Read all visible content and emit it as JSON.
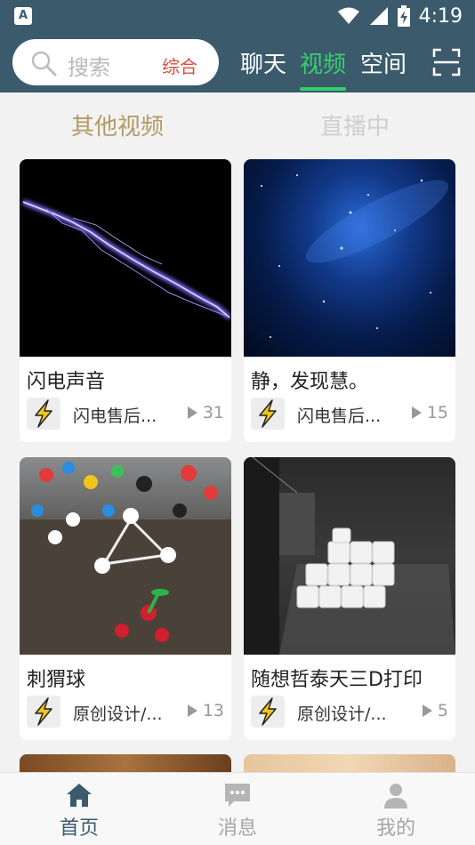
{
  "status_bar": {
    "time": "4:19",
    "notification_icon": "text-a-icon",
    "icons": [
      "wifi-icon",
      "signal-icon",
      "battery-charging-icon"
    ]
  },
  "header": {
    "search": {
      "placeholder": "搜索",
      "scope": "综合"
    },
    "tabs": [
      {
        "label": "聊天",
        "active": false
      },
      {
        "label": "视频",
        "active": true
      },
      {
        "label": "空间",
        "active": false
      }
    ],
    "scan_icon": "scan-icon",
    "accent_color": "#34d06b",
    "header_color": "#3b5b6d"
  },
  "subtabs": [
    {
      "label": "其他视频",
      "active": true
    },
    {
      "label": "直播中",
      "active": false
    }
  ],
  "videos": [
    {
      "title": "闪电声音",
      "author": "闪电售后...",
      "plays": "31",
      "thumb": "lightning"
    },
    {
      "title": "静，发现慧。",
      "author": "闪电售后...",
      "plays": "15",
      "thumb": "milky-way"
    },
    {
      "title": "刺猬球",
      "author": "原创设计/...",
      "plays": "13",
      "thumb": "molecule-toys"
    },
    {
      "title": "随想哲泰天三D打印",
      "author": "原创设计/...",
      "plays": "5",
      "thumb": "3d-printer"
    }
  ],
  "bottom_nav": [
    {
      "label": "首页",
      "icon": "home-icon",
      "active": true
    },
    {
      "label": "消息",
      "icon": "message-icon",
      "active": false
    },
    {
      "label": "我的",
      "icon": "user-icon",
      "active": false
    }
  ]
}
